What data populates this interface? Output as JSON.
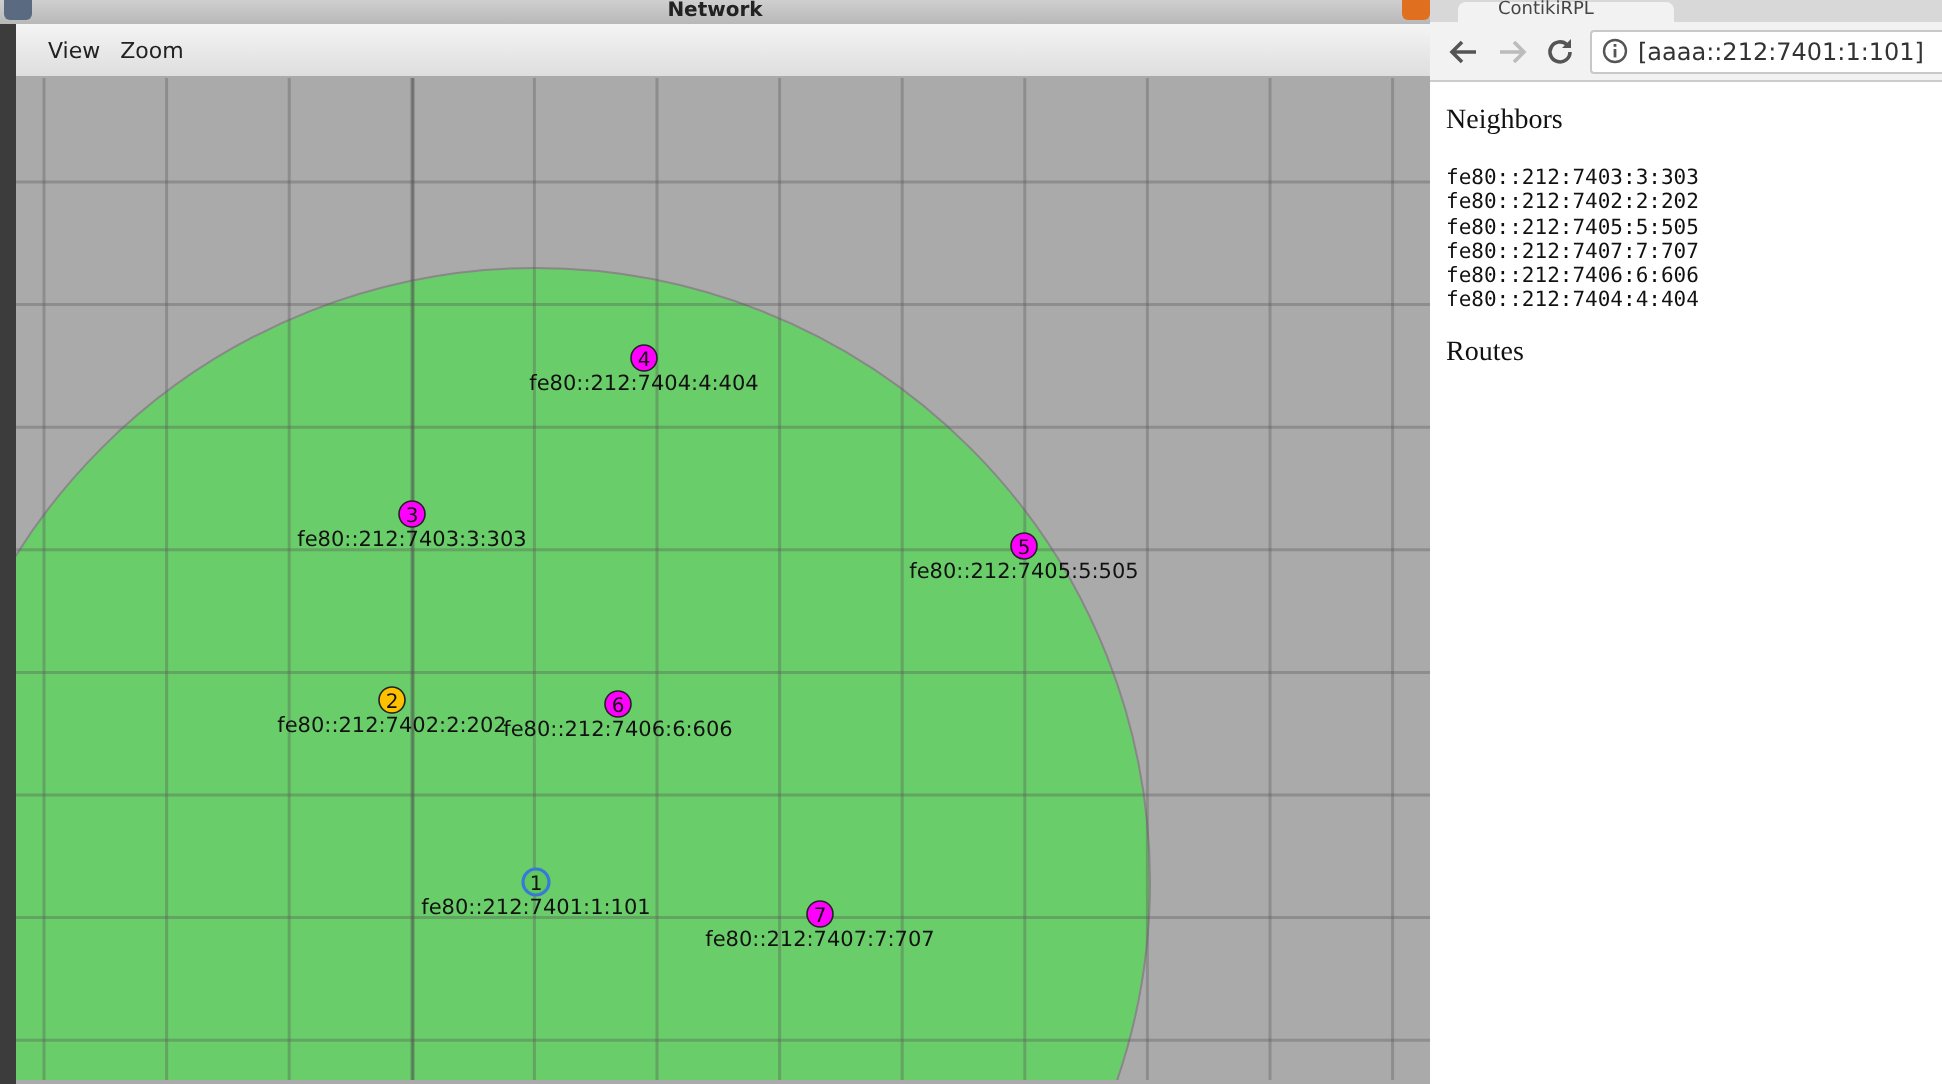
{
  "network_window": {
    "title": "Network",
    "menu": [
      "View",
      "Zoom"
    ],
    "nodes": [
      {
        "id": "4",
        "address": "fe80::212:7404:4:404",
        "color": "#ff00ff",
        "selected": false
      },
      {
        "id": "3",
        "address": "fe80::212:7403:3:303",
        "color": "#ff00ff",
        "selected": false
      },
      {
        "id": "5",
        "address": "fe80::212:7405:5:505",
        "color": "#ff00ff",
        "selected": false
      },
      {
        "id": "2",
        "address": "fe80::212:7402:2:202",
        "color": "#ffc000",
        "selected": false
      },
      {
        "id": "6",
        "address": "fe80::212:7406:6:606",
        "color": "#ff00ff",
        "selected": false
      },
      {
        "id": "1",
        "address": "fe80::212:7401:1:101",
        "color": "#5fc85f",
        "selected": true
      },
      {
        "id": "7",
        "address": "fe80::212:7407:7:707",
        "color": "#ff00ff",
        "selected": false
      }
    ]
  },
  "browser": {
    "tab_title": "ContikiRPL",
    "url": "[aaaa::212:7401:1:101]",
    "forward_disabled": true,
    "sections": [
      {
        "heading": "Neighbors",
        "lines": [
          "fe80::212:7403:3:303",
          "fe80::212:7402:2:202",
          "fe80::212:7405:5:505",
          "fe80::212:7407:7:707",
          "fe80::212:7406:6:606",
          "fe80::212:7404:4:404"
        ]
      },
      {
        "heading": "Routes"
      }
    ]
  }
}
